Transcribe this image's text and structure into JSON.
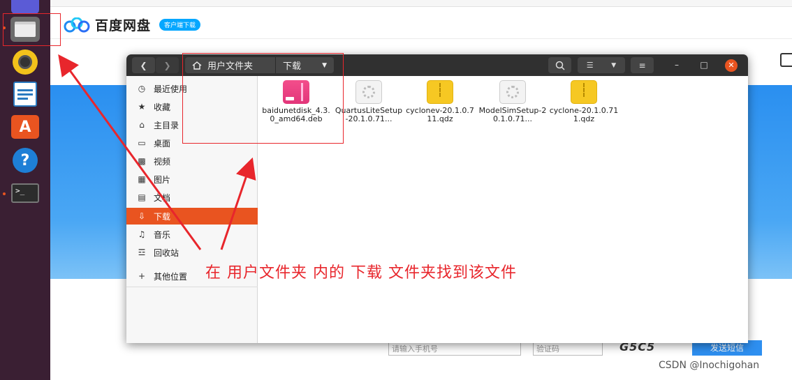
{
  "dock": {
    "items": [
      "files-app",
      "rhythmbox",
      "libreoffice-writer",
      "ubuntu-software",
      "help",
      "terminal"
    ]
  },
  "web": {
    "brand": "百度网盘",
    "client_badge": "客户端下载",
    "phone_placeholder": "请输入手机号",
    "code_placeholder": "验证码",
    "captcha": "G5C5",
    "send_sms": "发送短信",
    "watermark": "CSDN @Inochigohan"
  },
  "file_manager": {
    "breadcrumb": [
      "用户文件夹",
      "下载"
    ],
    "sidebar": [
      {
        "label": "最近使用",
        "icon": "clock-icon"
      },
      {
        "label": "收藏",
        "icon": "star-icon"
      },
      {
        "label": "主目录",
        "icon": "home-icon"
      },
      {
        "label": "桌面",
        "icon": "desktop-icon"
      },
      {
        "label": "视频",
        "icon": "video-icon"
      },
      {
        "label": "图片",
        "icon": "image-icon"
      },
      {
        "label": "文档",
        "icon": "document-icon"
      },
      {
        "label": "下载",
        "icon": "download-icon",
        "active": true
      },
      {
        "label": "音乐",
        "icon": "music-icon"
      },
      {
        "label": "回收站",
        "icon": "trash-icon"
      },
      {
        "label": "其他位置",
        "icon": "plus-icon"
      }
    ],
    "files": [
      {
        "name": "baidunetdisk_4.3.0_amd64.deb",
        "icon": "deb-package-icon"
      },
      {
        "name": "QuartusLiteSetup-20.1.0.71...",
        "icon": "executable-gear-icon"
      },
      {
        "name": "cyclonev-20.1.0.711.qdz",
        "icon": "archive-icon"
      },
      {
        "name": "ModelSimSetup-20.1.0.71...",
        "icon": "executable-gear-icon"
      },
      {
        "name": "cyclone-20.1.0.711.qdz",
        "icon": "archive-icon"
      }
    ]
  },
  "annotation": {
    "text": "在 用户文件夹 内的 下载 文件夹找到该文件",
    "color": "#e8262c"
  },
  "colors": {
    "ubuntu_orange": "#e95420",
    "dock_bg": "#3a1f33",
    "headerbar": "#303030",
    "baidu_blue": "#2a8ff0"
  }
}
